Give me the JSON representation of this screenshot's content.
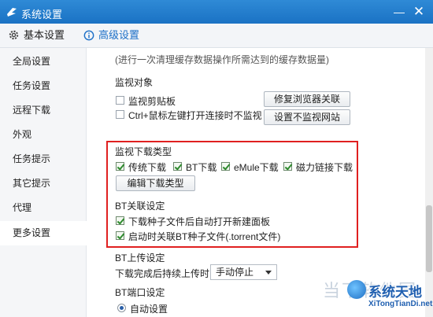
{
  "window": {
    "title": "系统设置",
    "minimize": "—",
    "close": "✕"
  },
  "tabs": {
    "basic": "基本设置",
    "advanced": "高级设置"
  },
  "sidebar": {
    "items": [
      {
        "label": "全局设置"
      },
      {
        "label": "任务设置"
      },
      {
        "label": "远程下载"
      },
      {
        "label": "外观"
      },
      {
        "label": "任务提示"
      },
      {
        "label": "其它提示"
      },
      {
        "label": "代理"
      },
      {
        "label": "更多设置",
        "active": true
      }
    ]
  },
  "main": {
    "cache_note": "(进行一次清理缓存数据操作所需达到的缓存数据量)",
    "monitor": {
      "title": "监视对象",
      "clipboard": {
        "label": "监视剪贴板",
        "checked": false
      },
      "ctrl_click": {
        "label": "Ctrl+鼠标左键打开连接时不监视",
        "checked": false
      },
      "repair_button": "修复浏览器关联",
      "exclude_button": "设置不监视网站"
    },
    "download_types": {
      "title": "监视下载类型",
      "traditional": {
        "label": "传统下载",
        "checked": true
      },
      "bt": {
        "label": "BT下载",
        "checked": true
      },
      "emule": {
        "label": "eMule下载",
        "checked": true
      },
      "magnet": {
        "label": "磁力链接下载",
        "checked": true
      },
      "edit_button": "编辑下载类型"
    },
    "bt_assoc": {
      "title": "BT关联设定",
      "auto_open": {
        "label": "下载种子文件后自动打开新建面板",
        "checked": true
      },
      "startup_assoc": {
        "label": "启动时关联BT种子文件(.torrent文件)",
        "checked": true
      }
    },
    "bt_upload": {
      "title": "BT上传设定",
      "label": "下载完成后持续上传时间",
      "selected": "手动停止"
    },
    "bt_port": {
      "title": "BT端口设定",
      "auto": {
        "label": "自动设置",
        "selected": true
      }
    }
  },
  "watermark": {
    "faint": "当下软件园",
    "brand": "系统天地",
    "url": "XiTongTianDi.net"
  },
  "colors": {
    "titlebar": "#1a72c4",
    "accent": "#1c6fc7",
    "highlight_border": "#e02020",
    "check": "#2e8b2e"
  }
}
